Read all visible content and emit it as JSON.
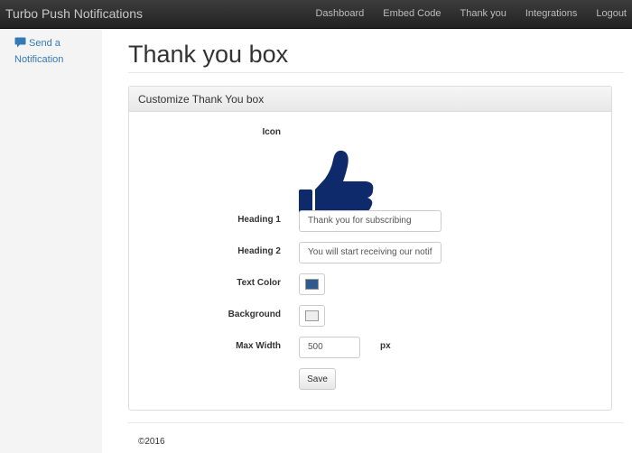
{
  "navbar": {
    "brand": "Turbo Push Notifications",
    "links": [
      "Dashboard",
      "Embed Code",
      "Thank you",
      "Integrations",
      "Logout"
    ]
  },
  "sidebar": {
    "items": [
      {
        "label": "Send a Notification",
        "icon": "comment-icon"
      }
    ]
  },
  "main": {
    "title": "Thank you box",
    "panel": {
      "heading": "Customize Thank You box",
      "icon_label": "Icon",
      "icon": "thumbs-up-icon",
      "icon_color": "#0f2a6b",
      "heading1_label": "Heading 1",
      "heading1_value": "Thank you for subscribing",
      "heading2_label": "Heading 2",
      "heading2_value": "You will start receiving our notif",
      "text_color_label": "Text Color",
      "text_color_value": "#2f5a8c",
      "background_label": "Background",
      "background_value": "#eeeeee",
      "max_width_label": "Max Width",
      "max_width_value": "500",
      "max_width_unit": "px",
      "save_label": "Save"
    }
  },
  "footer": {
    "copyright": "©2016"
  }
}
